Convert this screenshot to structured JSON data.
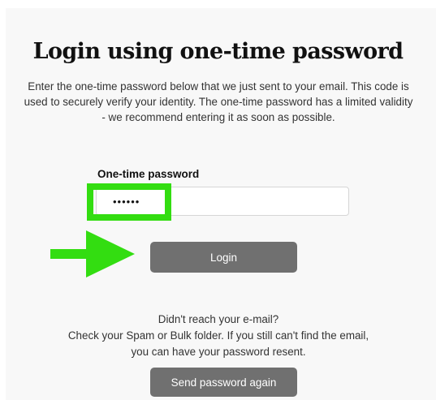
{
  "page": {
    "title": "Login using one-time password",
    "description": "Enter the one-time password below that we just sent to your email. This code is used to securely verify your identity. The one-time password has a limited validity - we recommend entering it as soon as possible."
  },
  "form": {
    "otp_label": "One-time password",
    "otp_value": "••••••",
    "login_label": "Login"
  },
  "help": {
    "line1": "Didn't reach your e-mail?",
    "line2": "Check your Spam or Bulk folder. If you still can't find the email,",
    "line3": "you can have your password resent.",
    "resend_label": "Send password again"
  },
  "annotations": {
    "highlight_color": "#33dd11",
    "arrow_icon": "right-arrow-icon"
  },
  "colors": {
    "button_bg": "#707070",
    "panel_bg": "#f8f8f8"
  }
}
